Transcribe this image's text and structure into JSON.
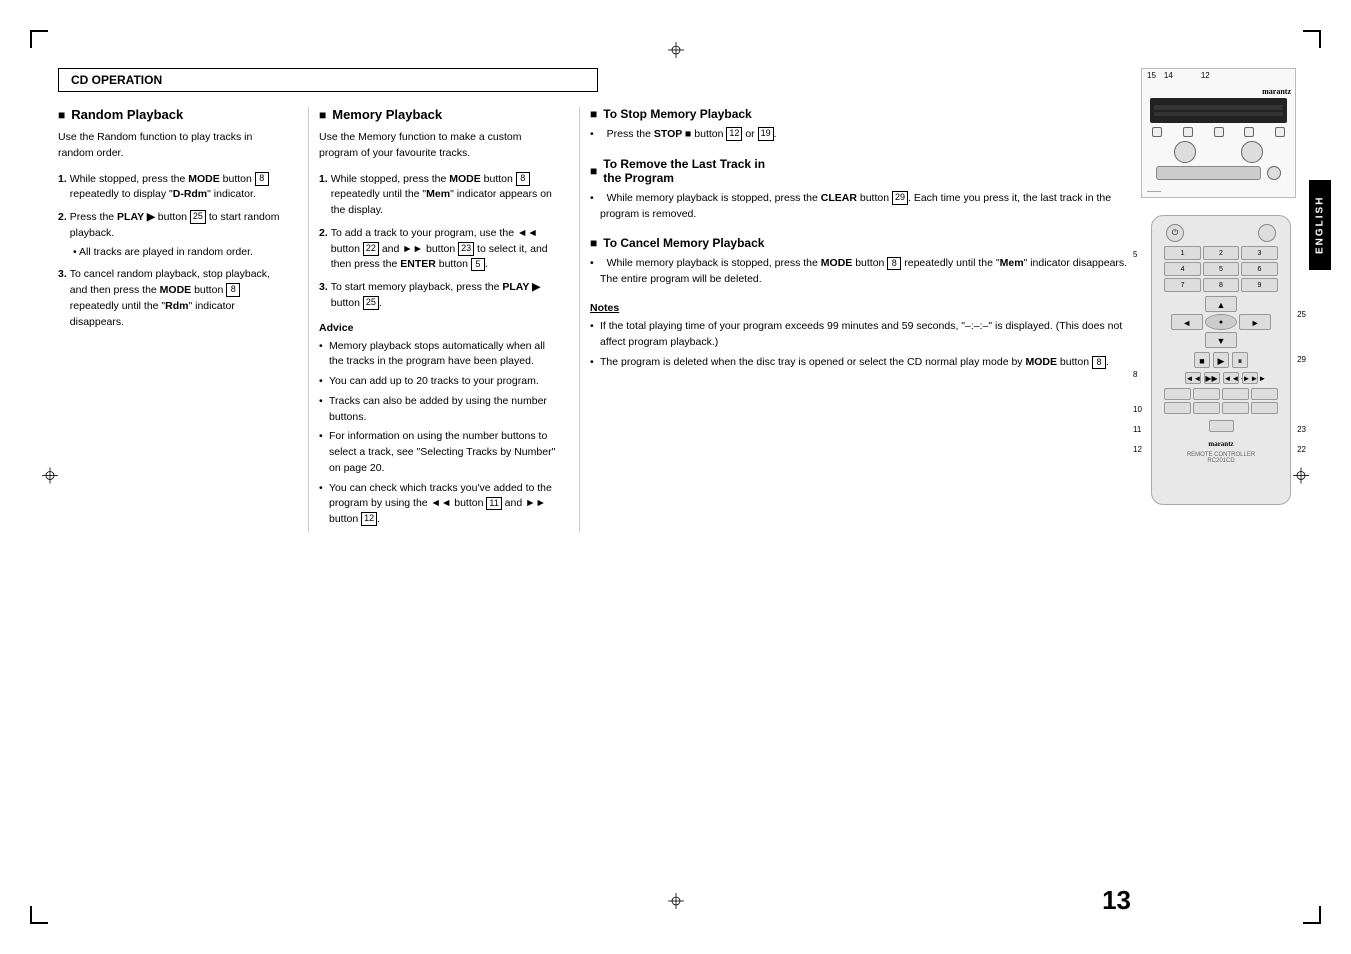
{
  "page": {
    "number": "13",
    "section_header": "CD OPERATION",
    "english_label": "ENGLISH"
  },
  "random_playback": {
    "title": "Random Playback",
    "intro": "Use the Random function to play tracks in random order.",
    "steps": [
      {
        "num": "1.",
        "text": "While stopped, press the ",
        "bold1": "MODE",
        "text2": " button ",
        "badge1": "8",
        "text3": " repeatedly to display \"",
        "bold2": "D-Rdm",
        "text4": "\" indicator."
      },
      {
        "num": "2.",
        "text": "Press the ",
        "bold1": "PLAY ▶",
        "text2": " button ",
        "badge1": "25",
        "text3": " to start random playback.",
        "bullet": "• All tracks are played in random order."
      },
      {
        "num": "3.",
        "text": "To cancel random playback, stop playback, and then press the ",
        "bold1": "MODE",
        "text2": " button ",
        "badge1": "8",
        "text3": " repeatedly until the \"",
        "bold2": "Rdm",
        "text4": "\" indicator disappears."
      }
    ]
  },
  "memory_playback": {
    "title": "Memory Playback",
    "intro": "Use the Memory function to make a custom program of your favourite tracks.",
    "steps": [
      {
        "num": "1.",
        "text": "While stopped, press the ",
        "bold1": "MODE",
        "text2": " button ",
        "badge1": "8",
        "text3": " repeatedly until the \"",
        "bold2": "Mem",
        "text4": "\" indicator appears on the display."
      },
      {
        "num": "2.",
        "text": "To add a track to your program, use the ",
        "bold1": "◄◄",
        "text2": " button ",
        "badge1": "22",
        "text3": " and ",
        "bold2": "►►",
        "text4": " button ",
        "badge2": "23",
        "text5": " to select it, and then press the ",
        "bold3": "ENTER",
        "text6": " button ",
        "badge3": "5",
        "text7": "."
      },
      {
        "num": "3.",
        "text": "To start memory playback, press the ",
        "bold1": "PLAY ▶",
        "text2": " button ",
        "badge1": "25",
        "text3": "."
      }
    ],
    "advice_title": "Advice",
    "advice_items": [
      "Memory playback stops automatically when all the tracks in the program have been played.",
      "You can add up to 20 tracks to your program.",
      "Tracks can also be added by using the number buttons.",
      "For information on using the number buttons to select a track, see \"Selecting Tracks by Number\" on page 20.",
      "You can check which tracks you've added to the program by using the ◄◄ button  and ►► button ."
    ],
    "advice_badge1": "11",
    "advice_badge2": "12"
  },
  "stop_memory": {
    "title": "To Stop Memory Playback",
    "text": "Press the ",
    "bold1": "STOP ■",
    "text2": " button ",
    "badge1": "12",
    "text3": " or ",
    "badge2": "19",
    "text4": "."
  },
  "remove_last_track": {
    "title": "To Remove the Last Track in the Program",
    "text": "While memory playback is stopped, press the ",
    "bold1": "CLEAR",
    "text2": " button ",
    "badge1": "29",
    "text3": ". Each time you press it, the last track in the program is removed."
  },
  "cancel_memory": {
    "title": "To Cancel Memory Playback",
    "text": "While memory playback is stopped, press the ",
    "bold1": "MODE",
    "text2": " button ",
    "badge1": "8",
    "text3": " repeatedly until the \"",
    "bold2": "Mem",
    "text4": "\" indicator disappears. The entire program will be deleted."
  },
  "notes": {
    "title": "Notes",
    "items": [
      "If the total playing time of your program exceeds 99 minutes and 59 seconds, \"–:–:–\" is displayed. (This does not affect program playback.)",
      "The program is deleted when the disc tray is opened or select the CD normal play mode by MODE button ."
    ],
    "badge1": "8"
  },
  "device_labels": {
    "top_numbers": "15  14   12",
    "bottom_labels": [
      "5",
      "8",
      "10",
      "11",
      "12"
    ],
    "right_numbers": [
      "25",
      "29",
      "23",
      "22"
    ]
  }
}
